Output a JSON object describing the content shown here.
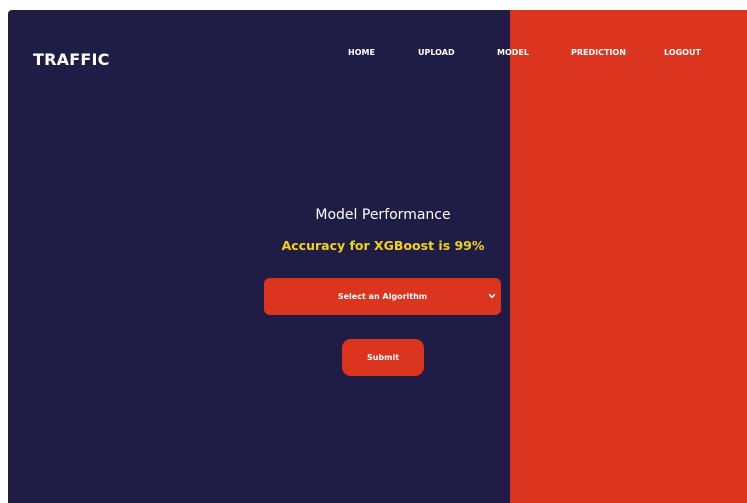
{
  "brand": "TRAFFIC",
  "nav": {
    "home": "HOME",
    "upload": "UPLOAD",
    "model": "MODEL",
    "prediction": "PREDICTION",
    "logout": "LOGOUT"
  },
  "main": {
    "heading": "Model Performance",
    "accuracy_text": "Accuracy for XGBoost is 99%",
    "algorithm_select": {
      "selected": "Select an Algorithm"
    },
    "submit_label": "Submit"
  },
  "colors": {
    "navy": "#1f1d45",
    "red": "#dc351f",
    "accent_yellow": "#f4d21b",
    "text": "#ffffff"
  }
}
